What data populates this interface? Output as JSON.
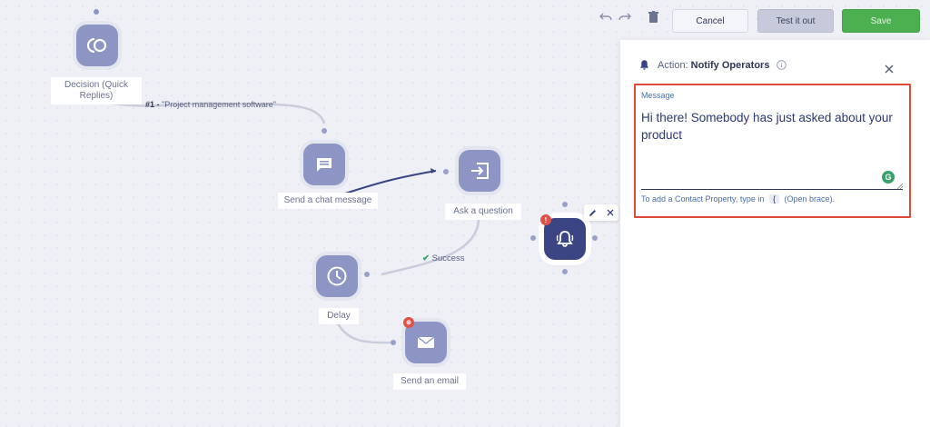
{
  "toolbar": {
    "cancel_label": "Cancel",
    "test_label": "Test it out",
    "save_label": "Save",
    "undo_icon": "undo-icon",
    "redo_icon": "redo-icon",
    "delete_icon": "trash-icon"
  },
  "flow": {
    "nodes": {
      "decision": {
        "label": "Decision (Quick Replies)",
        "icon": "decision-icon"
      },
      "chat": {
        "label": "Send a chat message",
        "icon": "chat-message-icon"
      },
      "question": {
        "label": "Ask a question",
        "icon": "ask-question-icon"
      },
      "notify": {
        "icon": "bell-icon",
        "badge": "!"
      },
      "delay": {
        "label": "Delay",
        "icon": "clock-icon"
      },
      "email": {
        "label": "Send an email",
        "icon": "envelope-icon"
      }
    },
    "edge_labels": {
      "option_number": "#1 -",
      "option_text": "\"Project management software\"",
      "success": "Success"
    }
  },
  "panel": {
    "prefix": "Action:",
    "name": "Notify Operators",
    "message_label": "Message",
    "message_text": "Hi there! Somebody has just asked about your product",
    "hint_before": "To add a Contact Property, type in",
    "hint_key": "{",
    "hint_after": "(Open brace)."
  },
  "colors": {
    "node": "#8d95c5",
    "active_node": "#3b4584",
    "save": "#4caf50",
    "highlight_border": "#dd4a3a"
  }
}
